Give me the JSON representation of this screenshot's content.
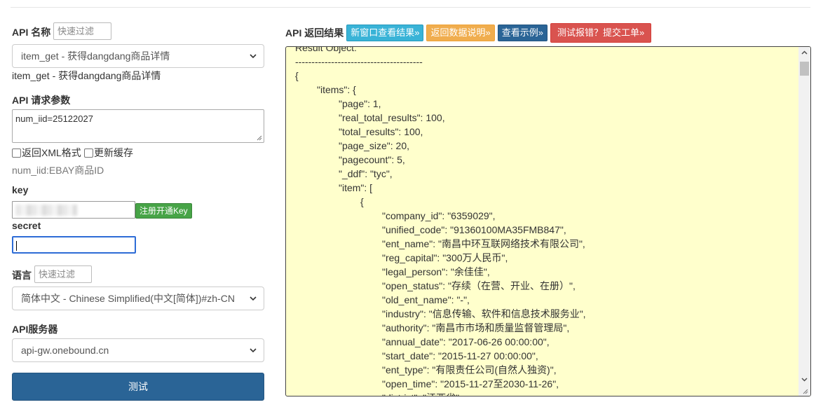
{
  "api_name": {
    "label": "API 名称",
    "filter_placeholder": "快速过滤",
    "selected": "item_get - 获得dangdang商品详情",
    "description": "item_get - 获得dangdang商品详情"
  },
  "params": {
    "label": "API 请求参数",
    "value": "num_iid=25122027",
    "xml_label": "返回XML格式",
    "cache_label": "更新缓存",
    "hint": "num_iid:EBAY商品ID"
  },
  "key": {
    "label": "key",
    "register_label": "注册开通Key"
  },
  "secret": {
    "label": "secret"
  },
  "language": {
    "label": "语言",
    "filter_placeholder": "快速过滤",
    "selected": "简体中文 - Chinese Simplified(中文[简体])#zh-CN"
  },
  "server": {
    "label": "API服务器",
    "selected": "api-gw.onebound.cn"
  },
  "submit_label": "测试",
  "result": {
    "title": "API 返回结果",
    "buttons": {
      "new_window": "新窗口查看结果»",
      "data_desc": "返回数据说明»",
      "example": "查看示例»",
      "report": "测试报错？提交工单»"
    },
    "lines": [
      "Result Object:",
      "---------------------------------------",
      "{",
      "\t\"items\": {",
      "\t\t\"page\": 1,",
      "\t\t\"real_total_results\": 100,",
      "\t\t\"total_results\": 100,",
      "\t\t\"page_size\": 20,",
      "\t\t\"pagecount\": 5,",
      "\t\t\"_ddf\": \"tyc\",",
      "\t\t\"item\": [",
      "\t\t\t{",
      "\t\t\t\t\"company_id\": \"6359029\",",
      "\t\t\t\t\"unified_code\": \"91360100MA35FMB847\",",
      "\t\t\t\t\"ent_name\": \"南昌中环互联网络技术有限公司\",",
      "\t\t\t\t\"reg_capital\": \"300万人民币\",",
      "\t\t\t\t\"legal_person\": \"余佳佳\",",
      "\t\t\t\t\"open_status\": \"存续（在营、开业、在册）\",",
      "\t\t\t\t\"old_ent_name\": \"-\",",
      "\t\t\t\t\"industry\": \"信息传输、软件和信息技术服务业\",",
      "\t\t\t\t\"authority\": \"南昌市市场和质量监督管理局\",",
      "\t\t\t\t\"annual_date\": \"2017-06-26 00:00:00\",",
      "\t\t\t\t\"start_date\": \"2015-11-27 00:00:00\",",
      "\t\t\t\t\"ent_type\": \"有限责任公司(自然人独资)\",",
      "\t\t\t\t\"open_time\": \"2015-11-27至2030-11-26\",",
      "\t\t\t\t\"district\": \"江西省\","
    ]
  },
  "icons": {
    "select_arrow": "chevron-down-icon",
    "scroll_up": "scroll-up-icon",
    "scroll_down": "scroll-down-icon",
    "resize": "resize-grip-icon"
  },
  "colors": {
    "primary": "#2a6496",
    "info": "#39b3d7",
    "warning": "#f0ad4e",
    "danger": "#d9534f",
    "success": "#47a447",
    "result_bg": "#ffffcc",
    "focus": "#2d6cd6"
  }
}
